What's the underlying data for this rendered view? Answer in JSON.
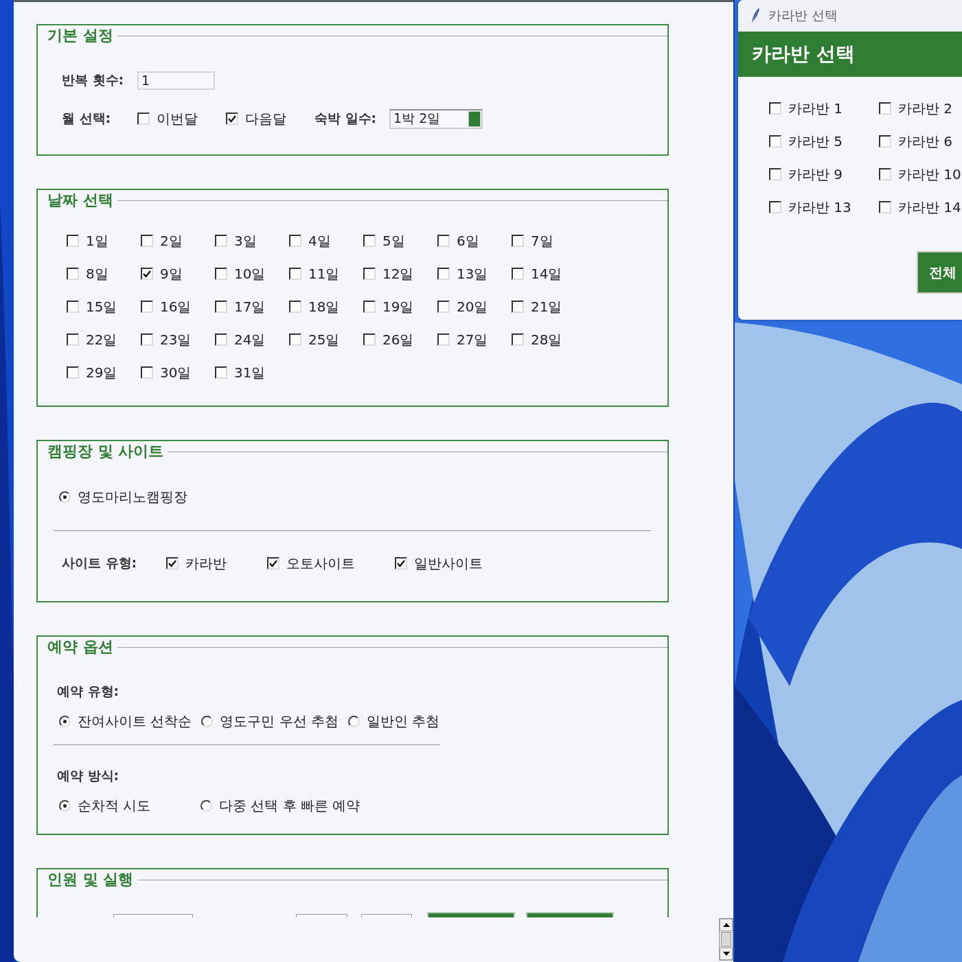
{
  "basic_settings": {
    "title": "기본 설정",
    "repeat_label": "반복 횟수:",
    "repeat_value": "1",
    "month_label": "월 선택:",
    "months": [
      {
        "label": "이번달",
        "checked": false
      },
      {
        "label": "다음달",
        "checked": true
      }
    ],
    "nights_label": "숙박 일수:",
    "nights_value": "1박 2일"
  },
  "date_selection": {
    "title": "날짜 선택",
    "days": [
      {
        "label": "1일",
        "checked": false
      },
      {
        "label": "2일",
        "checked": false
      },
      {
        "label": "3일",
        "checked": false
      },
      {
        "label": "4일",
        "checked": false
      },
      {
        "label": "5일",
        "checked": false
      },
      {
        "label": "6일",
        "checked": false
      },
      {
        "label": "7일",
        "checked": false
      },
      {
        "label": "8일",
        "checked": false
      },
      {
        "label": "9일",
        "checked": true
      },
      {
        "label": "10일",
        "checked": false
      },
      {
        "label": "11일",
        "checked": false
      },
      {
        "label": "12일",
        "checked": false
      },
      {
        "label": "13일",
        "checked": false
      },
      {
        "label": "14일",
        "checked": false
      },
      {
        "label": "15일",
        "checked": false
      },
      {
        "label": "16일",
        "checked": false
      },
      {
        "label": "17일",
        "checked": false
      },
      {
        "label": "18일",
        "checked": false
      },
      {
        "label": "19일",
        "checked": false
      },
      {
        "label": "20일",
        "checked": false
      },
      {
        "label": "21일",
        "checked": false
      },
      {
        "label": "22일",
        "checked": false
      },
      {
        "label": "23일",
        "checked": false
      },
      {
        "label": "24일",
        "checked": false
      },
      {
        "label": "25일",
        "checked": false
      },
      {
        "label": "26일",
        "checked": false
      },
      {
        "label": "27일",
        "checked": false
      },
      {
        "label": "28일",
        "checked": false
      },
      {
        "label": "29일",
        "checked": false
      },
      {
        "label": "30일",
        "checked": false
      },
      {
        "label": "31일",
        "checked": false
      }
    ]
  },
  "campsite": {
    "title": "캠핑장 및 사이트",
    "campgrounds": [
      {
        "label": "영도마리노캠핑장",
        "selected": true
      }
    ],
    "site_type_label": "사이트 유형:",
    "site_types": [
      {
        "label": "카라반",
        "checked": true
      },
      {
        "label": "오토사이트",
        "checked": true
      },
      {
        "label": "일반사이트",
        "checked": true
      }
    ]
  },
  "reservation_options": {
    "title": "예약 옵션",
    "type_label": "예약 유형:",
    "types": [
      {
        "label": "잔여사이트 선착순",
        "selected": true
      },
      {
        "label": "영도구민 우선 추첨",
        "selected": false
      },
      {
        "label": "일반인 추첨",
        "selected": false
      }
    ],
    "method_label": "예약 방식:",
    "methods": [
      {
        "label": "순차적 시도",
        "selected": true
      },
      {
        "label": "다중 선택 후 빠른 예약",
        "selected": false
      }
    ]
  },
  "people_and_run": {
    "title": "인원 및 실행"
  },
  "caravan_dialog": {
    "window_title": "카라반 선택",
    "header": "카라반 선택",
    "caravans": [
      {
        "label": "카라반 1",
        "checked": false
      },
      {
        "label": "카라반 2",
        "checked": false
      },
      {
        "label": "카라반 5",
        "checked": false
      },
      {
        "label": "카라반 6",
        "checked": false
      },
      {
        "label": "카라반 9",
        "checked": false
      },
      {
        "label": "카라반 10",
        "checked": false
      },
      {
        "label": "카라반 13",
        "checked": false
      },
      {
        "label": "카라반 14",
        "checked": false
      }
    ],
    "select_all_button": "전체"
  }
}
